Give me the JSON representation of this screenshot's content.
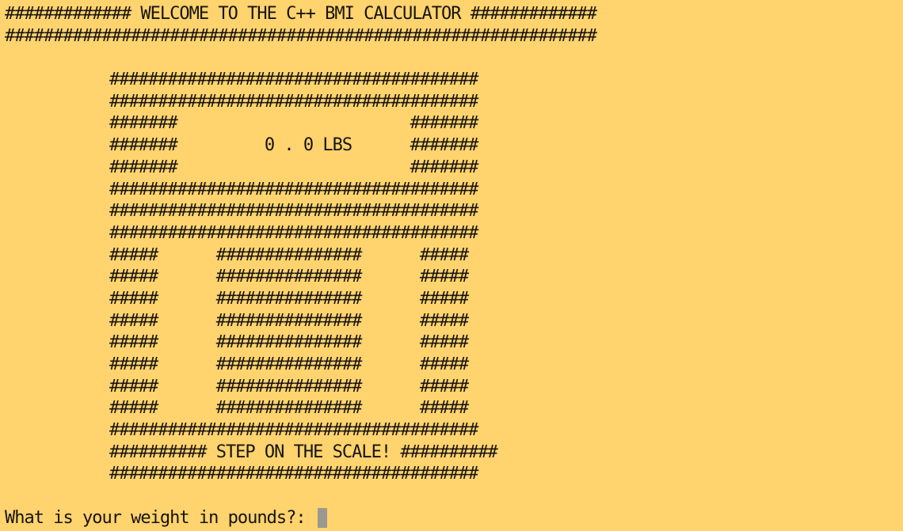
{
  "terminal": {
    "header_line_1": "############# WELCOME TO THE C++ BMI CALCULATOR #############",
    "header_line_2": "#############################################################",
    "scale_art": [
      "######################################",
      "######################################",
      "#######                        #######",
      "#######         0 . 0 LBS      #######",
      "#######                        #######",
      "######################################",
      "######################################",
      "######################################",
      "#####      ###############      #####",
      "#####      ###############      #####",
      "#####      ###############      #####",
      "#####      ###############      #####",
      "#####      ###############      #####",
      "#####      ###############      #####",
      "#####      ###############      #####",
      "#####      ###############      #####",
      "######################################",
      "########## STEP ON THE SCALE! ##########",
      "######################################"
    ],
    "prompt": "What is your weight in pounds?: ",
    "input_value": ""
  },
  "colors": {
    "background": "#ffd36e",
    "text": "#161410",
    "cursor": "#9b9891"
  }
}
